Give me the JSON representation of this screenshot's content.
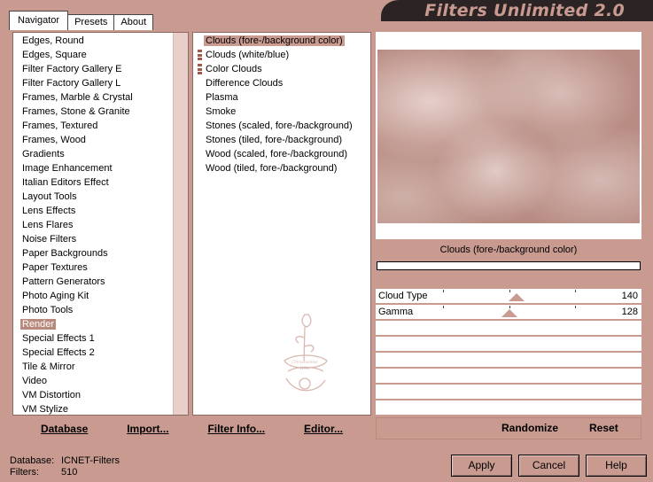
{
  "title": "Filters Unlimited 2.0",
  "tabs": [
    {
      "label": "Navigator",
      "active": true
    },
    {
      "label": "Presets",
      "active": false
    },
    {
      "label": "About",
      "active": false
    }
  ],
  "categories": [
    "Edges, Round",
    "Edges, Square",
    "Filter Factory Gallery E",
    "Filter Factory Gallery L",
    "Frames, Marble & Crystal",
    "Frames, Stone & Granite",
    "Frames, Textured",
    "Frames, Wood",
    "Gradients",
    "Image Enhancement",
    "Italian Editors Effect",
    "Layout Tools",
    "Lens Effects",
    "Lens Flares",
    "Noise Filters",
    "Paper Backgrounds",
    "Paper Textures",
    "Pattern Generators",
    "Photo Aging Kit",
    "Photo Tools",
    "Render",
    "Special Effects 1",
    "Special Effects 2",
    "Tile & Mirror",
    "Video",
    "VM Distortion",
    "VM Stylize"
  ],
  "selected_category": "Render",
  "filters": [
    {
      "label": "Clouds (fore-/background color)",
      "marker": false
    },
    {
      "label": "Clouds (white/blue)",
      "marker": true
    },
    {
      "label": "Color Clouds",
      "marker": true
    },
    {
      "label": "Difference Clouds",
      "marker": false
    },
    {
      "label": "Plasma",
      "marker": false
    },
    {
      "label": "Smoke",
      "marker": false
    },
    {
      "label": "Stones (scaled, fore-/background)",
      "marker": false
    },
    {
      "label": "Stones (tiled, fore-/background)",
      "marker": false
    },
    {
      "label": "Wood (scaled, fore-/background)",
      "marker": false
    },
    {
      "label": "Wood (tiled, fore-/background)",
      "marker": false
    }
  ],
  "selected_filter_name": "Clouds (fore-/background color)",
  "parameters": [
    {
      "label": "Cloud Type",
      "value": "140",
      "fraction": 0.55
    },
    {
      "label": "Gamma",
      "value": "128",
      "fraction": 0.5
    }
  ],
  "bottom_links": {
    "database": "Database",
    "import": "Import...",
    "filter_info": "Filter Info...",
    "editor": "Editor...",
    "randomize": "Randomize",
    "reset": "Reset"
  },
  "status": {
    "database_label": "Database:",
    "database_value": "ICNET-Filters",
    "filters_label": "Filters:",
    "filters_value": "510"
  },
  "buttons": {
    "apply": "Apply",
    "cancel": "Cancel",
    "help": "Help"
  },
  "colors": {
    "background": "#c89a90",
    "selection": "#b88a7e",
    "title_bar": "#2c2424"
  }
}
